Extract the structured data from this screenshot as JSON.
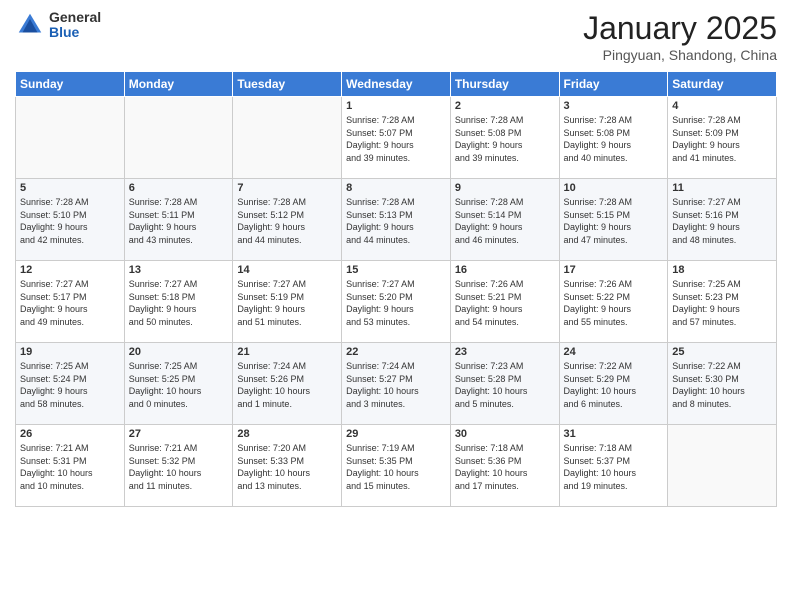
{
  "header": {
    "logo": {
      "general": "General",
      "blue": "Blue"
    },
    "title": "January 2025",
    "subtitle": "Pingyuan, Shandong, China"
  },
  "weekdays": [
    "Sunday",
    "Monday",
    "Tuesday",
    "Wednesday",
    "Thursday",
    "Friday",
    "Saturday"
  ],
  "weeks": [
    [
      {
        "day": "",
        "info": ""
      },
      {
        "day": "",
        "info": ""
      },
      {
        "day": "",
        "info": ""
      },
      {
        "day": "1",
        "info": "Sunrise: 7:28 AM\nSunset: 5:07 PM\nDaylight: 9 hours\nand 39 minutes."
      },
      {
        "day": "2",
        "info": "Sunrise: 7:28 AM\nSunset: 5:08 PM\nDaylight: 9 hours\nand 39 minutes."
      },
      {
        "day": "3",
        "info": "Sunrise: 7:28 AM\nSunset: 5:08 PM\nDaylight: 9 hours\nand 40 minutes."
      },
      {
        "day": "4",
        "info": "Sunrise: 7:28 AM\nSunset: 5:09 PM\nDaylight: 9 hours\nand 41 minutes."
      }
    ],
    [
      {
        "day": "5",
        "info": "Sunrise: 7:28 AM\nSunset: 5:10 PM\nDaylight: 9 hours\nand 42 minutes."
      },
      {
        "day": "6",
        "info": "Sunrise: 7:28 AM\nSunset: 5:11 PM\nDaylight: 9 hours\nand 43 minutes."
      },
      {
        "day": "7",
        "info": "Sunrise: 7:28 AM\nSunset: 5:12 PM\nDaylight: 9 hours\nand 44 minutes."
      },
      {
        "day": "8",
        "info": "Sunrise: 7:28 AM\nSunset: 5:13 PM\nDaylight: 9 hours\nand 44 minutes."
      },
      {
        "day": "9",
        "info": "Sunrise: 7:28 AM\nSunset: 5:14 PM\nDaylight: 9 hours\nand 46 minutes."
      },
      {
        "day": "10",
        "info": "Sunrise: 7:28 AM\nSunset: 5:15 PM\nDaylight: 9 hours\nand 47 minutes."
      },
      {
        "day": "11",
        "info": "Sunrise: 7:27 AM\nSunset: 5:16 PM\nDaylight: 9 hours\nand 48 minutes."
      }
    ],
    [
      {
        "day": "12",
        "info": "Sunrise: 7:27 AM\nSunset: 5:17 PM\nDaylight: 9 hours\nand 49 minutes."
      },
      {
        "day": "13",
        "info": "Sunrise: 7:27 AM\nSunset: 5:18 PM\nDaylight: 9 hours\nand 50 minutes."
      },
      {
        "day": "14",
        "info": "Sunrise: 7:27 AM\nSunset: 5:19 PM\nDaylight: 9 hours\nand 51 minutes."
      },
      {
        "day": "15",
        "info": "Sunrise: 7:27 AM\nSunset: 5:20 PM\nDaylight: 9 hours\nand 53 minutes."
      },
      {
        "day": "16",
        "info": "Sunrise: 7:26 AM\nSunset: 5:21 PM\nDaylight: 9 hours\nand 54 minutes."
      },
      {
        "day": "17",
        "info": "Sunrise: 7:26 AM\nSunset: 5:22 PM\nDaylight: 9 hours\nand 55 minutes."
      },
      {
        "day": "18",
        "info": "Sunrise: 7:25 AM\nSunset: 5:23 PM\nDaylight: 9 hours\nand 57 minutes."
      }
    ],
    [
      {
        "day": "19",
        "info": "Sunrise: 7:25 AM\nSunset: 5:24 PM\nDaylight: 9 hours\nand 58 minutes."
      },
      {
        "day": "20",
        "info": "Sunrise: 7:25 AM\nSunset: 5:25 PM\nDaylight: 10 hours\nand 0 minutes."
      },
      {
        "day": "21",
        "info": "Sunrise: 7:24 AM\nSunset: 5:26 PM\nDaylight: 10 hours\nand 1 minute."
      },
      {
        "day": "22",
        "info": "Sunrise: 7:24 AM\nSunset: 5:27 PM\nDaylight: 10 hours\nand 3 minutes."
      },
      {
        "day": "23",
        "info": "Sunrise: 7:23 AM\nSunset: 5:28 PM\nDaylight: 10 hours\nand 5 minutes."
      },
      {
        "day": "24",
        "info": "Sunrise: 7:22 AM\nSunset: 5:29 PM\nDaylight: 10 hours\nand 6 minutes."
      },
      {
        "day": "25",
        "info": "Sunrise: 7:22 AM\nSunset: 5:30 PM\nDaylight: 10 hours\nand 8 minutes."
      }
    ],
    [
      {
        "day": "26",
        "info": "Sunrise: 7:21 AM\nSunset: 5:31 PM\nDaylight: 10 hours\nand 10 minutes."
      },
      {
        "day": "27",
        "info": "Sunrise: 7:21 AM\nSunset: 5:32 PM\nDaylight: 10 hours\nand 11 minutes."
      },
      {
        "day": "28",
        "info": "Sunrise: 7:20 AM\nSunset: 5:33 PM\nDaylight: 10 hours\nand 13 minutes."
      },
      {
        "day": "29",
        "info": "Sunrise: 7:19 AM\nSunset: 5:35 PM\nDaylight: 10 hours\nand 15 minutes."
      },
      {
        "day": "30",
        "info": "Sunrise: 7:18 AM\nSunset: 5:36 PM\nDaylight: 10 hours\nand 17 minutes."
      },
      {
        "day": "31",
        "info": "Sunrise: 7:18 AM\nSunset: 5:37 PM\nDaylight: 10 hours\nand 19 minutes."
      },
      {
        "day": "",
        "info": ""
      }
    ]
  ]
}
